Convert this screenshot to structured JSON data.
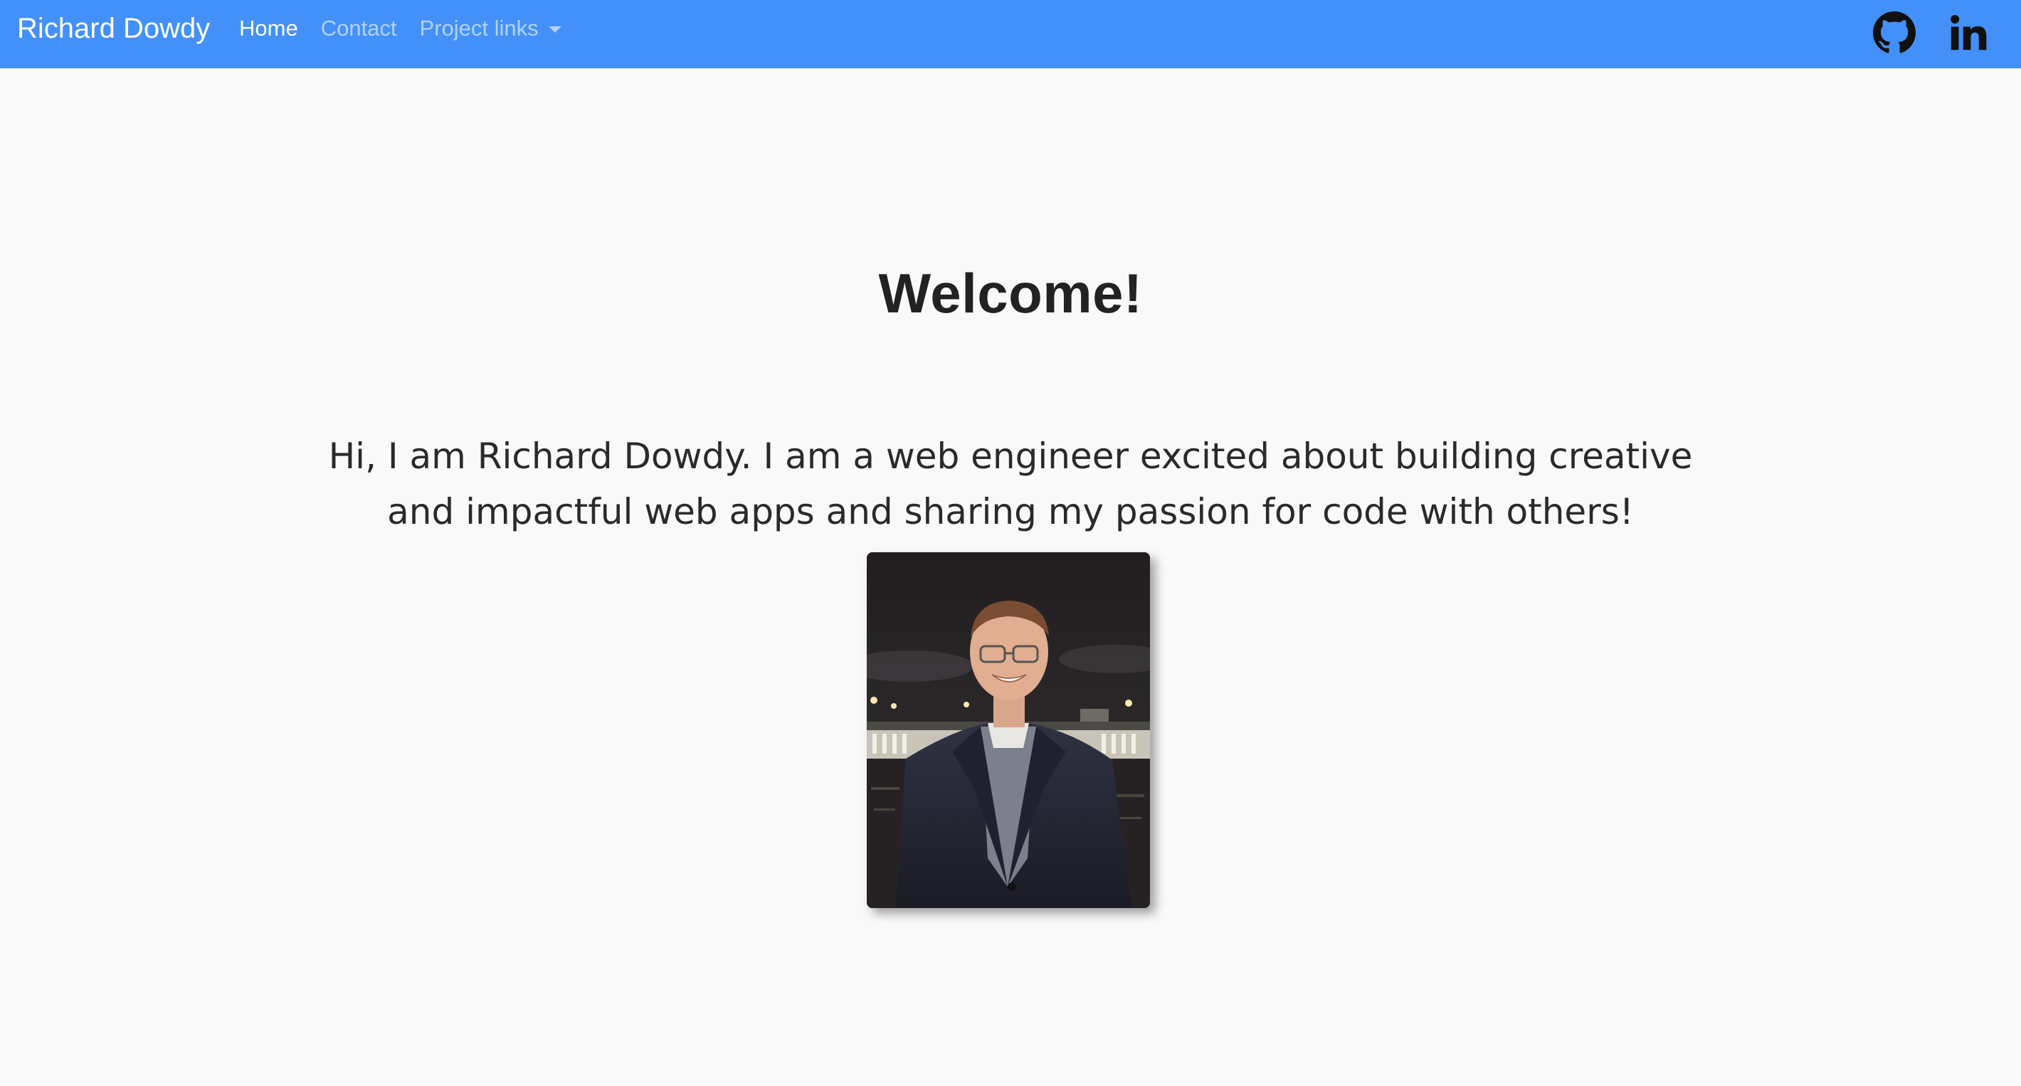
{
  "navbar": {
    "brand": "Richard Dowdy",
    "links": [
      {
        "label": "Home",
        "active": true
      },
      {
        "label": "Contact",
        "active": false
      }
    ],
    "dropdown": {
      "label": "Project links"
    },
    "social_icons": [
      "github-icon",
      "linkedin-icon"
    ],
    "background_color": "#4390f8"
  },
  "main": {
    "title": "Welcome!",
    "intro": "Hi, I am Richard Dowdy. I am a web engineer excited about building creative and impactful web apps and sharing my passion for code with others!"
  },
  "colors": {
    "page_background": "#f9f9f9",
    "text": "#212529"
  }
}
